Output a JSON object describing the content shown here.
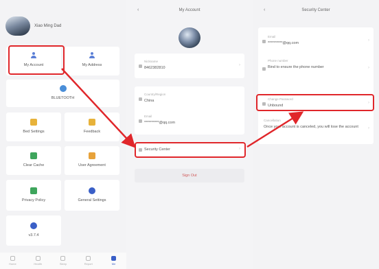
{
  "panel1": {
    "username": "Xiao Ming Dad",
    "tiles": [
      {
        "label": "My Account",
        "icon": "person-icon",
        "color": "#5b7fd6"
      },
      {
        "label": "My Address",
        "icon": "person-icon",
        "color": "#6b8dd8"
      },
      {
        "label": "BLUETOOTH",
        "icon": "bluetooth-icon",
        "color": "#4a8ed8"
      },
      {
        "label": "Bed Settings",
        "icon": "bed-icon",
        "color": "#e7b23a"
      },
      {
        "label": "Feedback",
        "icon": "feedback-icon",
        "color": "#e7b23a"
      },
      {
        "label": "Clear Cache",
        "icon": "trash-icon",
        "color": "#3ea55c"
      },
      {
        "label": "User Agreement",
        "icon": "document-icon",
        "color": "#e7a23a"
      },
      {
        "label": "Privacy Policy",
        "icon": "shield-icon",
        "color": "#3ea55c"
      },
      {
        "label": "General Settings",
        "icon": "gear-icon",
        "color": "#3a5fc7"
      },
      {
        "label": "v3.7.4",
        "icon": "info-icon",
        "color": "#3a5fc7"
      }
    ],
    "tabbar": [
      "Home",
      "Health",
      "Sleep",
      "Report",
      "Me"
    ]
  },
  "panel2": {
    "title": "My Account",
    "rows": [
      {
        "label": "Nickname",
        "value": "8462382810"
      },
      {
        "label": "Country/Region",
        "value": "China"
      },
      {
        "label": "Email",
        "value": "**********@qq.com"
      },
      {
        "label": "",
        "value": "Security Center"
      }
    ],
    "signout": "Sign Out"
  },
  "panel3": {
    "title": "Security Center",
    "rows": [
      {
        "label": "Email",
        "value": "**********@qq.com"
      },
      {
        "label": "Phone number",
        "value": "Bind to ensure the phone number"
      },
      {
        "label": "Change Password",
        "value": "Unbound"
      },
      {
        "label": "Cancellation",
        "value": "Once your account is canceled, you will lose the account"
      }
    ]
  }
}
